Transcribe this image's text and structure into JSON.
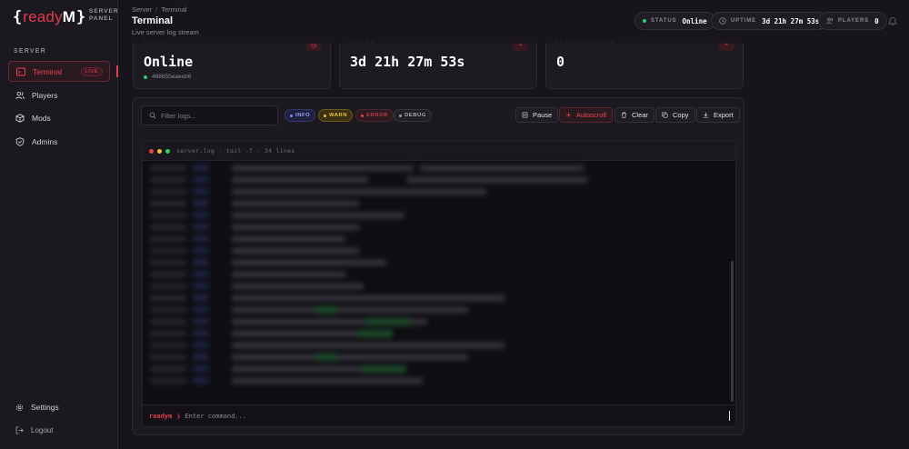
{
  "brand": {
    "brace_open": "{",
    "name": "ready",
    "m": "M",
    "brace_close": "}",
    "sub_line1": "SERVER",
    "sub_line2": "PANEL"
  },
  "sidebar": {
    "section": "SERVER",
    "items": [
      {
        "label": "Terminal",
        "icon": "terminal-icon",
        "badge": "LIVE",
        "active": true
      },
      {
        "label": "Players",
        "icon": "players-icon"
      },
      {
        "label": "Mods",
        "icon": "box-icon"
      },
      {
        "label": "Admins",
        "icon": "shield-icon"
      }
    ],
    "settings": "Settings",
    "logout": "Logout"
  },
  "header": {
    "breadcrumb": [
      "Server",
      "Terminal"
    ],
    "title": "Terminal",
    "subtitle": "Live server log stream",
    "status_label": "STATUS",
    "status_value": "Online",
    "uptime_label": "UPTIME",
    "uptime_value": "3d 21h 27m 53s",
    "players_label": "PLAYERS",
    "players_value": "0"
  },
  "cards": [
    {
      "label": "STATUS",
      "value": "Online",
      "sub": "488655eaeeb6"
    },
    {
      "label": "UPTIME",
      "value": "3d 21h 27m 53s"
    },
    {
      "label": "PLAYERS ONLINE",
      "value": "0"
    }
  ],
  "toolbar": {
    "search_placeholder": "Filter logs...",
    "filters": [
      "INFO",
      "WARN",
      "ERROR",
      "DEBUG"
    ],
    "pause": "Pause",
    "autoscroll": "Autoscroll",
    "clear": "Clear",
    "copy": "Copy",
    "export": "Export"
  },
  "terminal": {
    "title": "server.log · tail -f · 34 lines",
    "prompt_user": "readym",
    "prompt_arrow": "❯",
    "input_placeholder": "Enter command..."
  },
  "colors": {
    "accent": "#e23b4e",
    "online": "#2ecc71",
    "info": "#7b8cff",
    "warn": "#f0c23a",
    "error": "#e8434f",
    "debug": "#9a97a0"
  }
}
